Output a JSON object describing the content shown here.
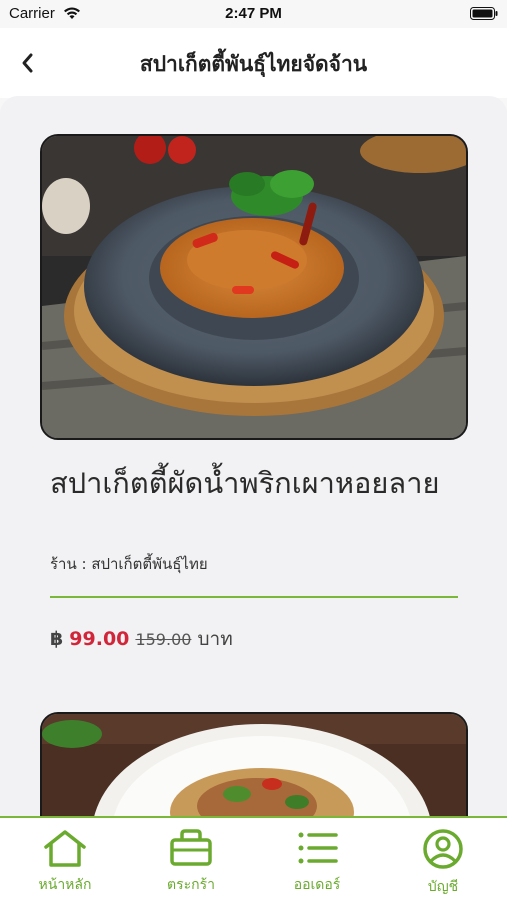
{
  "status": {
    "carrier": "Carrier",
    "time": "2:47 PM"
  },
  "header": {
    "title": "สปาเก็ตตี้พันธุ์ไทยจัดจ้าน"
  },
  "product": {
    "title": "สปาเก็ตตี้ผัดน้ำพริกเผาหอยลาย",
    "shop": "ร้าน : สปาเก็ตตี้พันธุ์ไทย",
    "currency": "฿",
    "price": "99.00",
    "original_price": "159.00",
    "unit": "บาท"
  },
  "tabs": [
    {
      "label": "หน้าหลัก",
      "icon": "home-icon"
    },
    {
      "label": "ตระกร้า",
      "icon": "basket-icon"
    },
    {
      "label": "ออเดอร์",
      "icon": "list-icon"
    },
    {
      "label": "บัญชี",
      "icon": "account-icon"
    }
  ],
  "colors": {
    "accent": "#7bb83a",
    "price": "#d1263a"
  }
}
